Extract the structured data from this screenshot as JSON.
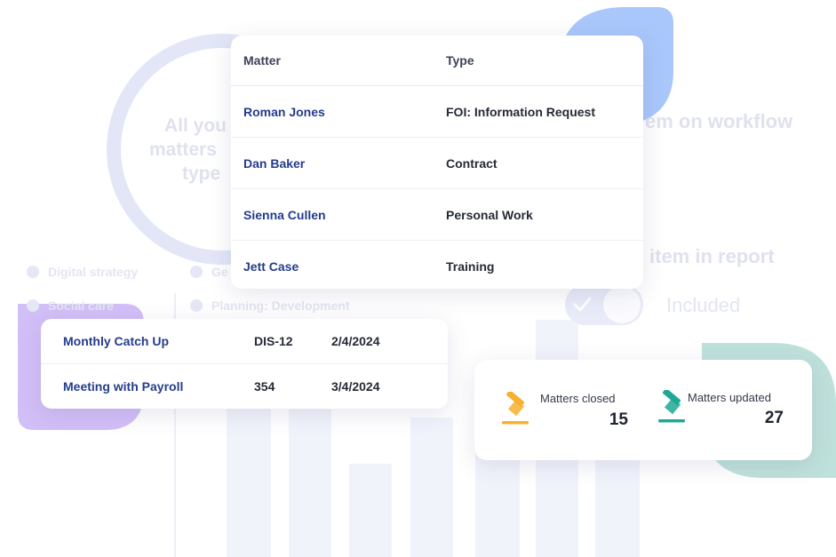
{
  "background": {
    "circle_text": [
      "All you",
      "matters",
      "type"
    ],
    "workflow_text": "em on workflow",
    "report_text": "item in report",
    "toggle_label": "Included",
    "legend": [
      {
        "label": "Digital strategy"
      },
      {
        "label": "Ge"
      },
      {
        "label": "Social care"
      },
      {
        "label": "Planning: Development"
      }
    ]
  },
  "matters_table": {
    "headers": {
      "matter": "Matter",
      "type": "Type"
    },
    "rows": [
      {
        "matter": "Roman Jones",
        "type": "FOI: Information Request"
      },
      {
        "matter": "Dan Baker",
        "type": "Contract"
      },
      {
        "matter": "Sienna Cullen",
        "type": "Personal Work"
      },
      {
        "matter": "Jett Case",
        "type": "Training"
      }
    ]
  },
  "meetings": [
    {
      "name": "Monthly Catch Up",
      "code": "DIS-12",
      "date": "2/4/2024"
    },
    {
      "name": "Meeting with Payroll",
      "code": "354",
      "date": "3/4/2024"
    }
  ],
  "stats": {
    "closed": {
      "label": "Matters closed",
      "value": "15",
      "icon": "gavel-icon",
      "color": "#f7b02f"
    },
    "updated": {
      "label": "Matters updated",
      "value": "27",
      "icon": "gavel-icon",
      "color": "#1fa895"
    }
  },
  "colors": {
    "link_blue": "#243c8c",
    "blob_blue": "#a9c7fb",
    "blob_purple": "#cdb6f5",
    "blob_teal": "#b8ded8"
  }
}
